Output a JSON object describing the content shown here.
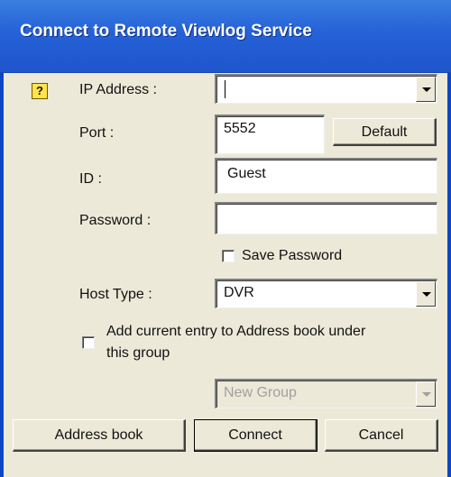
{
  "window": {
    "title": "Connect to Remote Viewlog Service"
  },
  "form": {
    "ip_label": "IP Address :",
    "ip_value": "",
    "port_label": "Port :",
    "port_value": "5552",
    "default_label": "Default",
    "id_label": "ID :",
    "id_value": "Guest",
    "password_label": "Password :",
    "password_value": "",
    "save_password_label": "Save Password",
    "save_password_checked": false,
    "host_type_label": "Host Type :",
    "host_type_value": "DVR",
    "add_entry_label_line1": "Add current entry to Address book under",
    "add_entry_label_line2": "this group",
    "add_entry_checked": false,
    "group_value": "New Group"
  },
  "buttons": {
    "address_book": "Address book",
    "connect": "Connect",
    "cancel": "Cancel"
  },
  "icons": {
    "help": "?"
  }
}
